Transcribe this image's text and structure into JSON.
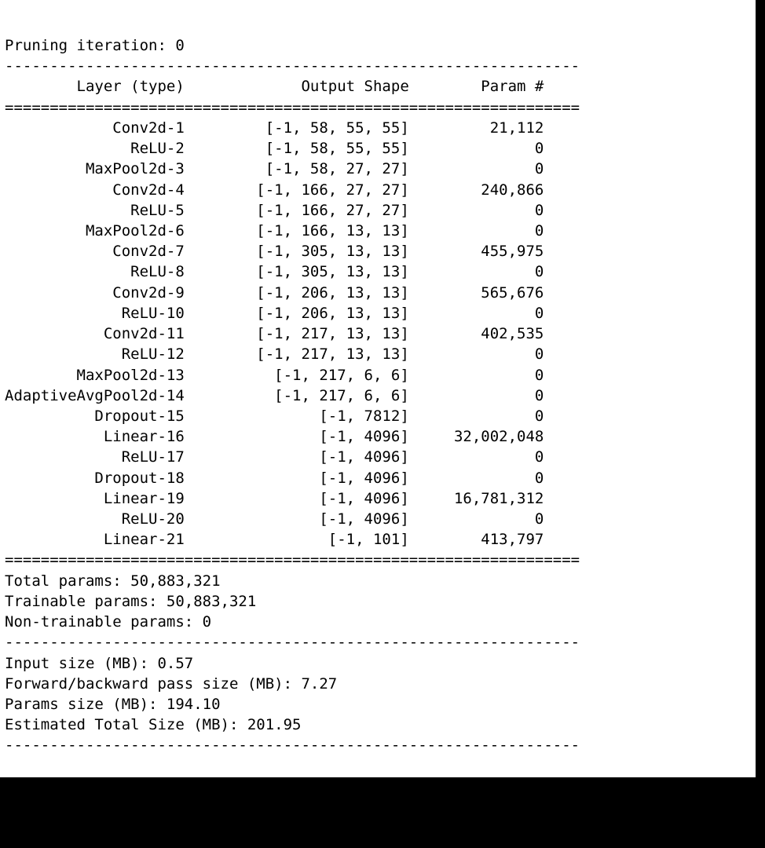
{
  "header_line": "Pruning iteration: 0",
  "col_headers": {
    "layer": "Layer (type)",
    "shape": "Output Shape",
    "param": "Param #"
  },
  "rows": [
    {
      "layer": "Conv2d-1",
      "shape": "[-1, 58, 55, 55]",
      "param": "21,112"
    },
    {
      "layer": "ReLU-2",
      "shape": "[-1, 58, 55, 55]",
      "param": "0"
    },
    {
      "layer": "MaxPool2d-3",
      "shape": "[-1, 58, 27, 27]",
      "param": "0"
    },
    {
      "layer": "Conv2d-4",
      "shape": "[-1, 166, 27, 27]",
      "param": "240,866"
    },
    {
      "layer": "ReLU-5",
      "shape": "[-1, 166, 27, 27]",
      "param": "0"
    },
    {
      "layer": "MaxPool2d-6",
      "shape": "[-1, 166, 13, 13]",
      "param": "0"
    },
    {
      "layer": "Conv2d-7",
      "shape": "[-1, 305, 13, 13]",
      "param": "455,975"
    },
    {
      "layer": "ReLU-8",
      "shape": "[-1, 305, 13, 13]",
      "param": "0"
    },
    {
      "layer": "Conv2d-9",
      "shape": "[-1, 206, 13, 13]",
      "param": "565,676"
    },
    {
      "layer": "ReLU-10",
      "shape": "[-1, 206, 13, 13]",
      "param": "0"
    },
    {
      "layer": "Conv2d-11",
      "shape": "[-1, 217, 13, 13]",
      "param": "402,535"
    },
    {
      "layer": "ReLU-12",
      "shape": "[-1, 217, 13, 13]",
      "param": "0"
    },
    {
      "layer": "MaxPool2d-13",
      "shape": "[-1, 217, 6, 6]",
      "param": "0"
    },
    {
      "layer": "AdaptiveAvgPool2d-14",
      "shape": "[-1, 217, 6, 6]",
      "param": "0"
    },
    {
      "layer": "Dropout-15",
      "shape": "[-1, 7812]",
      "param": "0"
    },
    {
      "layer": "Linear-16",
      "shape": "[-1, 4096]",
      "param": "32,002,048"
    },
    {
      "layer": "ReLU-17",
      "shape": "[-1, 4096]",
      "param": "0"
    },
    {
      "layer": "Dropout-18",
      "shape": "[-1, 4096]",
      "param": "0"
    },
    {
      "layer": "Linear-19",
      "shape": "[-1, 4096]",
      "param": "16,781,312"
    },
    {
      "layer": "ReLU-20",
      "shape": "[-1, 4096]",
      "param": "0"
    },
    {
      "layer": "Linear-21",
      "shape": "[-1, 101]",
      "param": "413,797"
    }
  ],
  "totals": {
    "total_params": "Total params: 50,883,321",
    "trainable_params": "Trainable params: 50,883,321",
    "nontrainable": "Non-trainable params: 0"
  },
  "sizes": {
    "input": "Input size (MB): 0.57",
    "fwd_bwd": "Forward/backward pass size (MB): 7.27",
    "params": "Params size (MB): 194.10",
    "est_total": "Estimated Total Size (MB): 201.95"
  },
  "rule_chars": {
    "dash": "-",
    "eq": "="
  },
  "widths": {
    "total": 64,
    "col1": 20,
    "col2": 25,
    "col3": 15
  }
}
